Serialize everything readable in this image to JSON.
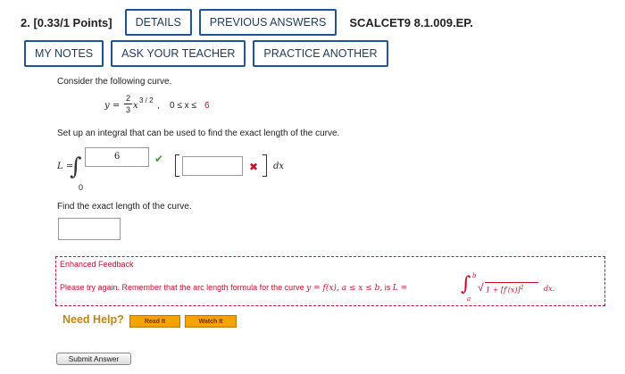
{
  "header": {
    "question_number": "2.",
    "points": "[0.33/1 Points]",
    "details_label": "DETAILS",
    "previous_answers_label": "PREVIOUS ANSWERS",
    "course_code": "SCALCET9 8.1.009.EP."
  },
  "toolbar": {
    "my_notes_label": "MY NOTES",
    "ask_teacher_label": "ASK YOUR TEACHER",
    "practice_another_label": "PRACTICE ANOTHER"
  },
  "problem": {
    "intro": "Consider the following curve.",
    "curve_y": "y =",
    "frac_num": "2",
    "frac_den": "3",
    "curve_x": "x",
    "curve_exp": "3 / 2",
    "comma": ",",
    "domain_left": "0 ≤ x ≤ ",
    "domain_upper": "6",
    "setup_prompt": "Set up an integral that can be used to find the exact length of the curve.",
    "L_equals": "L =",
    "lower_limit": "0",
    "upper_limit_answer": "6",
    "integrand_answer": "",
    "dx": "dx",
    "exact_length_prompt": "Find the exact length of the curve.",
    "exact_length_answer": ""
  },
  "status": {
    "upper_limit_mark": "✔",
    "integrand_mark": "✖",
    "correct_color": "#3a9b3a",
    "incorrect_color": "#c8102e"
  },
  "feedback": {
    "title": "Enhanced Feedback",
    "message": "Please try again. Remember that the arc length formula for the curve",
    "curve_expr": "y = f(x), a ≤ x ≤ b,",
    "is_text": "is",
    "formula_left": "L =",
    "integral_upper": "b",
    "integral_lower": "a",
    "integrand": "1 + [f′(x)]",
    "integrand_exp": "2",
    "dx": "dx."
  },
  "help": {
    "label": "Need Help?",
    "read_it_label": "Read It",
    "watch_it_label": "Watch It"
  },
  "submit": {
    "label": "Submit Answer"
  }
}
